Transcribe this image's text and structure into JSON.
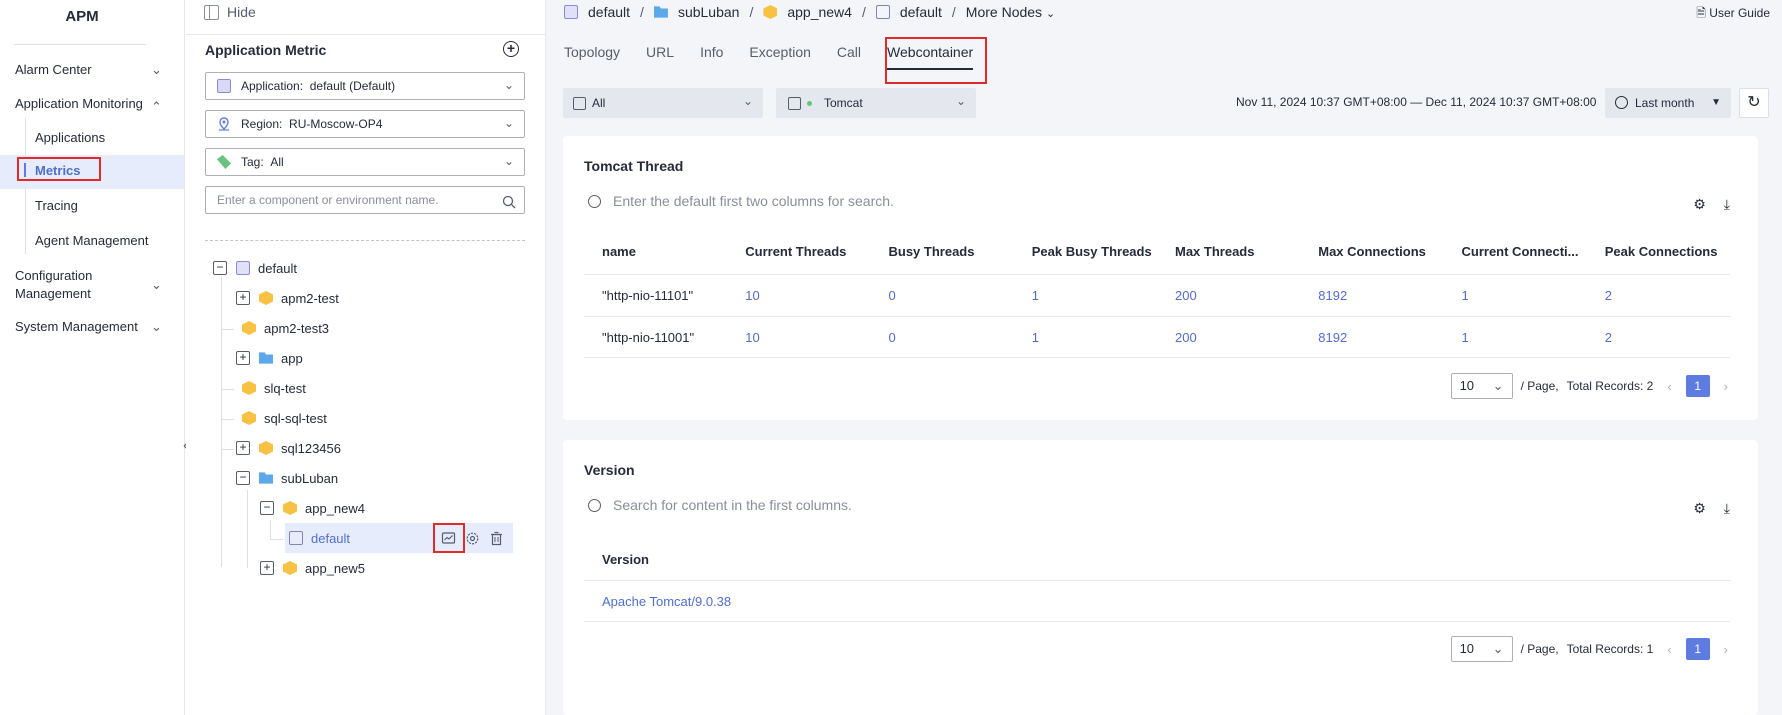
{
  "nav": {
    "brand": "APM",
    "groups": [
      {
        "label": "Alarm Center"
      },
      {
        "label": "Application Monitoring"
      },
      {
        "label": "Configuration Management"
      },
      {
        "label": "System Management"
      }
    ],
    "subitems": [
      "Applications",
      "Metrics",
      "Tracing",
      "Agent Management"
    ],
    "active": "Metrics"
  },
  "tree_panel": {
    "hide_label": "Hide",
    "title": "Application Metric",
    "application_label": "Application:",
    "application_value": "default (Default)",
    "region_label": "Region:",
    "region_value": "RU-Moscow-OP4",
    "tag_label": "Tag:",
    "tag_value": "All",
    "search_placeholder": "Enter a component or environment name.",
    "nodes": [
      "default",
      "apm2-test",
      "apm2-test3",
      "app",
      "slq-test",
      "sql-sql-test",
      "sql123456",
      "subLuban",
      "app_new4",
      "default",
      "app_new5"
    ]
  },
  "breadcrumb": {
    "items": [
      "default",
      "subLuban",
      "app_new4",
      "default",
      "More Nodes"
    ]
  },
  "user_guide": "User Guide",
  "tabs": [
    "Topology",
    "URL",
    "Info",
    "Exception",
    "Call",
    "Webcontainer"
  ],
  "active_tab": "Webcontainer",
  "filters": {
    "scope": "All",
    "container": "Tomcat",
    "date_range": "Nov 11, 2024 10:37 GMT+08:00 — Dec 11, 2024 10:37 GMT+08:00",
    "period": "Last month"
  },
  "thread_card": {
    "title": "Tomcat Thread",
    "search_placeholder": "Enter the default first two columns for search.",
    "columns": [
      "name",
      "Current Threads",
      "Busy Threads",
      "Peak Busy Threads",
      "Max Threads",
      "Max Connections",
      "Current Connecti...",
      "Peak Connections"
    ],
    "rows": [
      [
        "\"http-nio-11101\"",
        "10",
        "0",
        "1",
        "200",
        "8192",
        "1",
        "2"
      ],
      [
        "\"http-nio-11001\"",
        "10",
        "0",
        "1",
        "200",
        "8192",
        "1",
        "2"
      ]
    ],
    "page_size": "10",
    "per_page_label": "/ Page,",
    "total_label": "Total Records: 2",
    "page": "1"
  },
  "version_card": {
    "title": "Version",
    "search_placeholder": "Search for content in the first columns.",
    "column": "Version",
    "value": "Apache Tomcat/9.0.38",
    "page_size": "10",
    "per_page_label": "/ Page,",
    "total_label": "Total Records: 1",
    "page": "1"
  },
  "colors": {
    "accent": "#5e7ce0",
    "link": "#526ecc",
    "highlight_box": "#e32a2a",
    "selected_bg": "#e6ecfb"
  }
}
